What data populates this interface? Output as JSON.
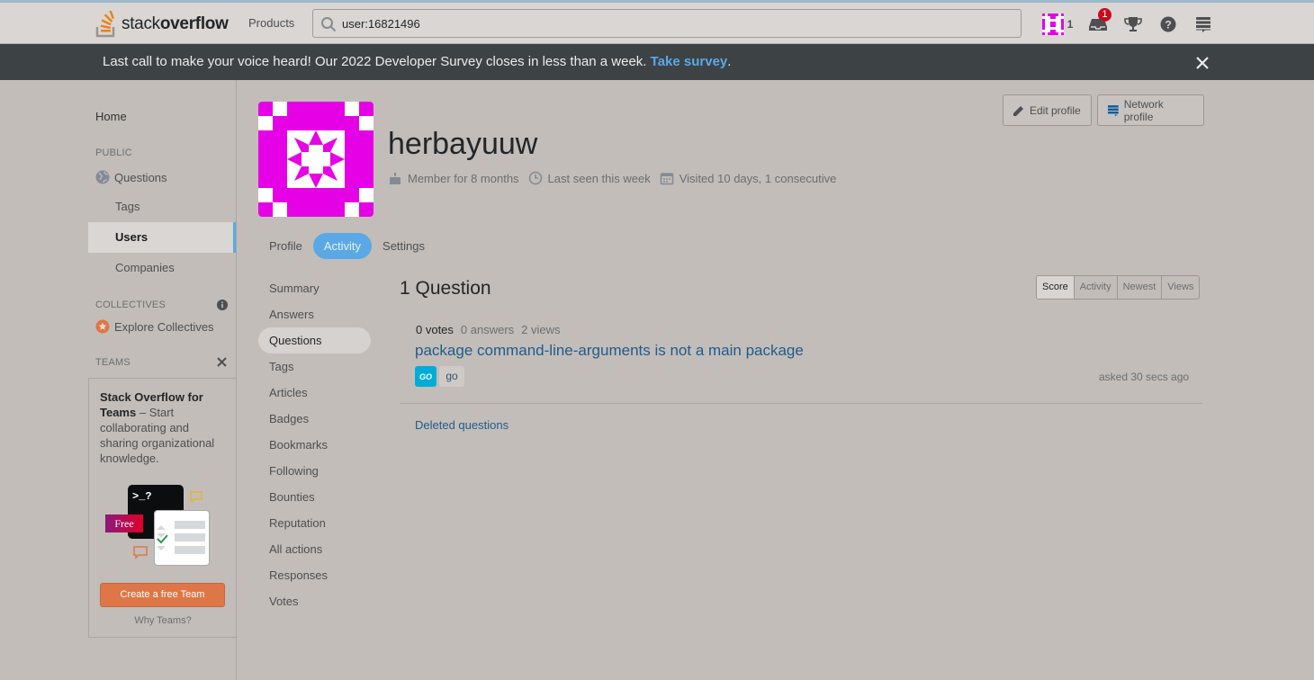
{
  "topbar": {
    "logo_text_light": "stack",
    "logo_text_bold": "overflow",
    "products_label": "Products",
    "search_value": "user:16821496",
    "reputation": "1",
    "inbox_count": "1",
    "accent": "#5aa9e6"
  },
  "banner": {
    "text": "Last call to make your voice heard! Our 2022 Developer Survey closes in less than a week.",
    "link": "Take survey",
    "trailing": "."
  },
  "leftnav": {
    "home": "Home",
    "public_heading": "PUBLIC",
    "questions": "Questions",
    "tags": "Tags",
    "users": "Users",
    "companies": "Companies",
    "collectives_heading": "COLLECTIVES",
    "explore_collectives": "Explore Collectives",
    "teams_heading": "TEAMS",
    "teams_title": "Stack Overflow for Teams",
    "teams_desc": "– Start collaborating and sharing organizational knowledge.",
    "free_label": "Free",
    "teams_prompt": ">_?",
    "create_team": "Create a free Team",
    "why_teams": "Why Teams?"
  },
  "profile": {
    "username": "herbayuuw",
    "member_for": "Member for 8 months",
    "last_seen": "Last seen this week",
    "visited": "Visited 10 days, 1 consecutive",
    "edit_profile": "Edit profile",
    "network_profile": "Network profile",
    "avatar_color": "#e600e6"
  },
  "tabs": [
    "Profile",
    "Activity",
    "Settings"
  ],
  "subnav": [
    "Summary",
    "Answers",
    "Questions",
    "Tags",
    "Articles",
    "Badges",
    "Bookmarks",
    "Following",
    "Bounties",
    "Reputation",
    "All actions",
    "Responses",
    "Votes"
  ],
  "questions": {
    "heading": "1 Question",
    "sort": [
      "Score",
      "Activity",
      "Newest",
      "Views"
    ],
    "item": {
      "votes": "0 votes",
      "answers": "0 answers",
      "views": "2 views",
      "title": "package command-line-arguments is not a main package",
      "tag_icon": "GO",
      "tag": "go",
      "asked": "asked 30 secs ago"
    },
    "deleted": "Deleted questions"
  }
}
